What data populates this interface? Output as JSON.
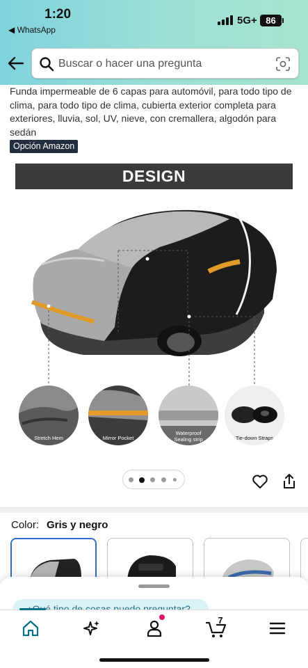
{
  "status_bar": {
    "time": "1:20",
    "back_app": "◀ WhatsApp",
    "network": "5G+",
    "battery": "86"
  },
  "search": {
    "placeholder": "Buscar o hacer una pregunta"
  },
  "product": {
    "title": "Funda impermeable de 6 capas para automóvil, para todo tipo de clima, para todo tipo de clima, cubierta exterior completa para exteriores, lluvia, sol, UV, nieve, con cremallera, algodón para sedán",
    "badge": "Opción Amazon"
  },
  "image": {
    "banner": "DESIGN",
    "features": [
      {
        "label": "Stretch Hem"
      },
      {
        "label": "Mirror Pocket"
      },
      {
        "label_line1": "Waterproof",
        "label_line2": "Sealing strip"
      },
      {
        "label": "Tie-down Straps"
      }
    ],
    "carousel": {
      "total": 5,
      "active": 2
    }
  },
  "color": {
    "label": "Color:",
    "value": "Gris y negro"
  },
  "assistant": {
    "prompt": "¿Qué tipo de cosas puedo preguntar?"
  },
  "nav": {
    "cart_count": "7"
  },
  "colors": {
    "accent": "#007185",
    "selected_border": "#2f6fc9",
    "badge_bg": "#232f3e",
    "header_start": "#7fd3de",
    "header_end": "#a6e3cf"
  }
}
